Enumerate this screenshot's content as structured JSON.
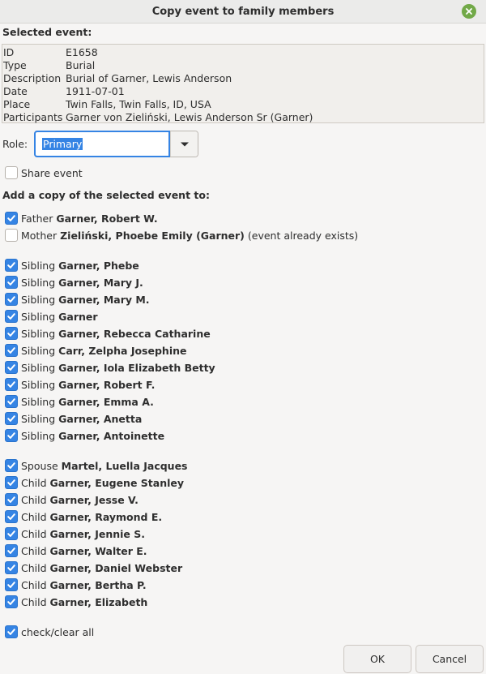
{
  "window": {
    "title": "Copy event to family members"
  },
  "selected_event": {
    "heading": "Selected event:",
    "rows": [
      {
        "label": "ID",
        "value": "E1658"
      },
      {
        "label": "Type",
        "value": "Burial"
      },
      {
        "label": "Description",
        "value": "Burial of Garner, Lewis Anderson"
      },
      {
        "label": "Date",
        "value": "1911-07-01"
      },
      {
        "label": "Place",
        "value": "Twin Falls, Twin Falls, ID, USA"
      },
      {
        "label": "Participants",
        "value": "Garner von Zieliński, Lewis Anderson Sr (Garner)"
      }
    ]
  },
  "role": {
    "label": "Role:",
    "value": "Primary"
  },
  "share_event": {
    "label": "Share event",
    "checked": false
  },
  "add_copy": {
    "heading": "Add a copy of the selected event to:",
    "members": [
      {
        "relation": "Father",
        "name": "Garner, Robert W.",
        "note": "",
        "checked": true
      },
      {
        "relation": "Mother",
        "name": "Zieliński, Phoebe Emily (Garner)",
        "note": "(event already exists)",
        "checked": false
      },
      {
        "relation": "Sibling",
        "name": "Garner, Phebe",
        "note": "",
        "checked": true
      },
      {
        "relation": "Sibling",
        "name": "Garner, Mary J.",
        "note": "",
        "checked": true
      },
      {
        "relation": "Sibling",
        "name": "Garner, Mary M.",
        "note": "",
        "checked": true
      },
      {
        "relation": "Sibling",
        "name": "Garner",
        "note": "",
        "checked": true
      },
      {
        "relation": "Sibling",
        "name": "Garner, Rebecca Catharine",
        "note": "",
        "checked": true
      },
      {
        "relation": "Sibling",
        "name": "Carr, Zelpha Josephine",
        "note": "",
        "checked": true
      },
      {
        "relation": "Sibling",
        "name": "Garner, Iola Elizabeth Betty",
        "note": "",
        "checked": true
      },
      {
        "relation": "Sibling",
        "name": "Garner, Robert F.",
        "note": "",
        "checked": true
      },
      {
        "relation": "Sibling",
        "name": "Garner, Emma A.",
        "note": "",
        "checked": true
      },
      {
        "relation": "Sibling",
        "name": "Garner, Anetta",
        "note": "",
        "checked": true
      },
      {
        "relation": "Sibling",
        "name": "Garner, Antoinette",
        "note": "",
        "checked": true
      },
      {
        "relation": "Spouse",
        "name": "Martel, Luella Jacques",
        "note": "",
        "checked": true
      },
      {
        "relation": "Child",
        "name": "Garner, Eugene Stanley",
        "note": "",
        "checked": true
      },
      {
        "relation": "Child",
        "name": "Garner, Jesse V.",
        "note": "",
        "checked": true
      },
      {
        "relation": "Child",
        "name": "Garner, Raymond E.",
        "note": "",
        "checked": true
      },
      {
        "relation": "Child",
        "name": "Garner, Jennie S.",
        "note": "",
        "checked": true
      },
      {
        "relation": "Child",
        "name": "Garner, Walter E.",
        "note": "",
        "checked": true
      },
      {
        "relation": "Child",
        "name": "Garner, Daniel Webster",
        "note": "",
        "checked": true
      },
      {
        "relation": "Child",
        "name": "Garner, Bertha P.",
        "note": "",
        "checked": true
      },
      {
        "relation": "Child",
        "name": "Garner, Elizabeth",
        "note": "",
        "checked": true
      }
    ]
  },
  "check_all": {
    "label": "check/clear all",
    "checked": true
  },
  "buttons": {
    "ok": "OK",
    "cancel": "Cancel"
  },
  "colors": {
    "accent": "#3584e4",
    "close": "#72a948"
  }
}
